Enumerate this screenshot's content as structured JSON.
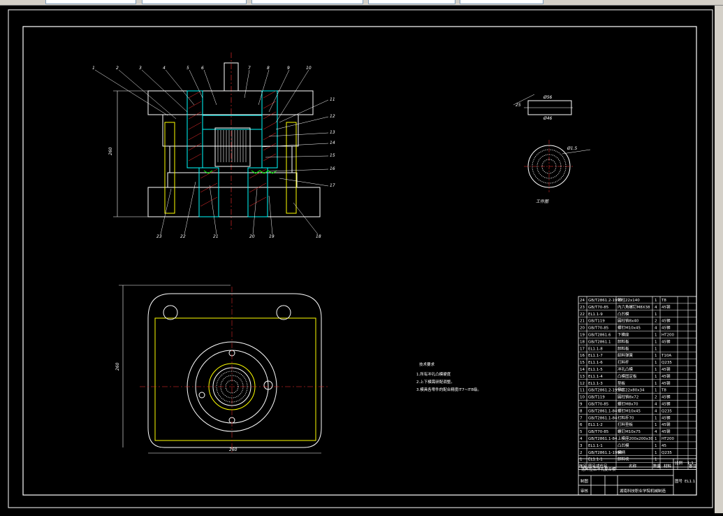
{
  "colors": {
    "background": "#000000",
    "line_white": "#ffffff",
    "line_yellow": "#ffff00",
    "line_red": "#ff3030",
    "line_green": "#00ff00",
    "line_cyan": "#00ffff",
    "toolbar": "#d4d0c8"
  },
  "drawing": {
    "part_numbers_top": [
      "1",
      "2",
      "3",
      "4",
      "5",
      "6",
      "7",
      "8",
      "9",
      "10"
    ],
    "part_numbers_right": [
      "11",
      "12",
      "13",
      "14",
      "15",
      "16",
      "17",
      "18"
    ],
    "part_numbers_bottom": [
      "23",
      "22",
      "21",
      "20",
      "19"
    ],
    "dim_height": "260",
    "dim_width_bottom": "260",
    "dim_left_plan": "260",
    "workpiece_caption": "工件图",
    "dim_workpiece_1": "Ø56",
    "dim_workpiece_2": "Ø46",
    "dim_workpiece_3": "25",
    "dim_hole": "Ø1.5"
  },
  "notes": {
    "title": "技术要求",
    "lines": [
      "1.所有冲孔凸模硬度",
      "2.上下模需研配调整。",
      "3.模具各零件的配合精度IT7~IT8级。"
    ]
  },
  "bom": {
    "rows": [
      {
        "no": "24",
        "code": "GB/T2861.2-1990",
        "name": "导柱22x140",
        "qty": "1",
        "mat": "T8"
      },
      {
        "no": "23",
        "code": "GB/T70-85",
        "name": "内六角螺钉M8X38",
        "qty": "4",
        "mat": "45钢"
      },
      {
        "no": "22",
        "code": "EL1.1-9",
        "name": "凸凹模",
        "qty": "1",
        "mat": ""
      },
      {
        "no": "21",
        "code": "GB/T119",
        "name": "圆柱销8x40",
        "qty": "2",
        "mat": "45钢"
      },
      {
        "no": "20",
        "code": "GB/T70-85",
        "name": "螺钉M10x45",
        "qty": "4",
        "mat": "45钢"
      },
      {
        "no": "19",
        "code": "GB/T2861.6",
        "name": "下模座",
        "qty": "1",
        "mat": "HT200"
      },
      {
        "no": "18",
        "code": "GB/T2861.1",
        "name": "卸料板",
        "qty": "1",
        "mat": "45钢"
      },
      {
        "no": "17",
        "code": "EL1.1-8",
        "name": "卸料板",
        "qty": "1",
        "mat": ""
      },
      {
        "no": "16",
        "code": "EL1.1-7",
        "name": "卸料弹簧",
        "qty": "1",
        "mat": "T10A"
      },
      {
        "no": "15",
        "code": "EL1.1-6",
        "name": "打料杆",
        "qty": "1",
        "mat": "Q235"
      },
      {
        "no": "14",
        "code": "EL1.1-5",
        "name": "冲孔凸模",
        "qty": "1",
        "mat": "45钢"
      },
      {
        "no": "13",
        "code": "EL1.1-4",
        "name": "凸模固定板",
        "qty": "1",
        "mat": "45钢"
      },
      {
        "no": "12",
        "code": "EL1.1-3",
        "name": "垫板",
        "qty": "1",
        "mat": "45钢"
      },
      {
        "no": "11",
        "code": "GB/T2861.2-1994",
        "name": "导套22x80x34",
        "qty": "1",
        "mat": "T8"
      },
      {
        "no": "10",
        "code": "GB/T119",
        "name": "圆柱销8x72",
        "qty": "2",
        "mat": "45钢"
      },
      {
        "no": "9",
        "code": "GB/T70-85",
        "name": "螺钉M8x70",
        "qty": "4",
        "mat": "45钢"
      },
      {
        "no": "8",
        "code": "GB/T2861.1-84",
        "name": "螺钉M10x45",
        "qty": "4",
        "mat": "Q235"
      },
      {
        "no": "7",
        "code": "GB/T2861.1-84",
        "name": "打料杆70",
        "qty": "1",
        "mat": "45钢"
      },
      {
        "no": "6",
        "code": "EL1.1-2",
        "name": "打料垫板",
        "qty": "1",
        "mat": "45钢"
      },
      {
        "no": "5",
        "code": "GB/T70-85",
        "name": "螺钉M10x75",
        "qty": "4",
        "mat": "45钢"
      },
      {
        "no": "4",
        "code": "GB/T2861.1-84",
        "name": "上模座200x200x30",
        "qty": "1",
        "mat": "HT200"
      },
      {
        "no": "3",
        "code": "EL1.1-1",
        "name": "凸凹模",
        "qty": "1",
        "mat": "45"
      },
      {
        "no": "2",
        "code": "GB/T2861.1-1990",
        "name": "模柄",
        "qty": "1",
        "mat": "Q235"
      },
      {
        "no": "1",
        "code": "EL1.1-1",
        "name": "卸料块",
        "qty": "1",
        "mat": ""
      }
    ],
    "header": {
      "no": "序号",
      "code": "图号或代号",
      "name": "名称",
      "qty": "数量",
      "mat": "材料",
      "note": "备注"
    },
    "title_main": "落料冲孔复合模",
    "title_sub": "落料拉深冲孔复合模",
    "drawing_no_label": "图号",
    "drawing_no": "EL1.1",
    "scale_label": "比例",
    "scale_value": "1:1",
    "row_labels": [
      "制图",
      "审核"
    ],
    "school": "湖南科技职业学院机械制造"
  }
}
